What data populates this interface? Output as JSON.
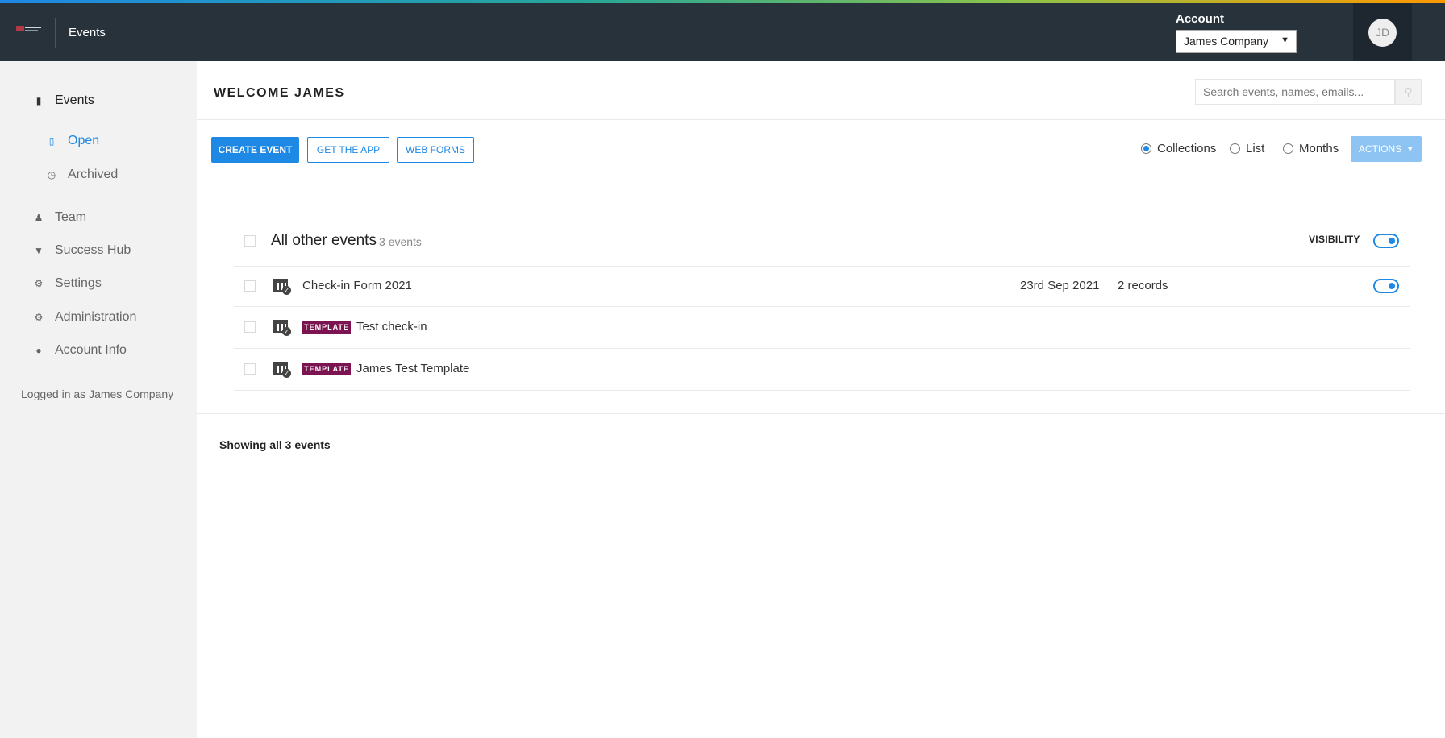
{
  "header": {
    "title": "Events",
    "account_label": "Account",
    "account_selected": "James Company",
    "avatar_initials": "JD"
  },
  "sidebar": {
    "items": [
      {
        "label": "Events",
        "icon": "clipboard-icon"
      },
      {
        "label": "Open",
        "icon": "document-icon"
      },
      {
        "label": "Archived",
        "icon": "clock-icon"
      },
      {
        "label": "Team",
        "icon": "user-icon"
      },
      {
        "label": "Success Hub",
        "icon": "trophy-icon"
      },
      {
        "label": "Settings",
        "icon": "gear-icon"
      },
      {
        "label": "Administration",
        "icon": "gear-icon"
      },
      {
        "label": "Account Info",
        "icon": "circle-icon"
      }
    ],
    "logged_in": "Logged in as James Company"
  },
  "main": {
    "welcome": "WELCOME JAMES",
    "search_placeholder": "Search events, names, emails...",
    "buttons": {
      "create": "CREATE EVENT",
      "get_app": "GET THE APP",
      "web_forms": "WEB FORMS",
      "actions": "ACTIONS"
    },
    "view_options": [
      {
        "label": "Collections",
        "selected": true
      },
      {
        "label": "List",
        "selected": false
      },
      {
        "label": "Months",
        "selected": false
      }
    ],
    "group": {
      "title": "All other events",
      "count": "3 events",
      "visibility_label": "VISIBILITY",
      "visibility_on": true
    },
    "events": [
      {
        "name": "Check-in Form 2021",
        "template": false,
        "date": "23rd Sep 2021",
        "records": "2 records",
        "visible": true
      },
      {
        "name": "Test check-in",
        "template": true,
        "badge": "TEMPLATE"
      },
      {
        "name": "James Test Template",
        "template": true,
        "badge": "TEMPLATE"
      }
    ],
    "footer": "Showing all 3 events"
  },
  "colors": {
    "header_bg": "#27323b",
    "accent": "#1e88e5",
    "template_badge": "#7b1450",
    "sidebar_bg": "#f2f2f2"
  }
}
